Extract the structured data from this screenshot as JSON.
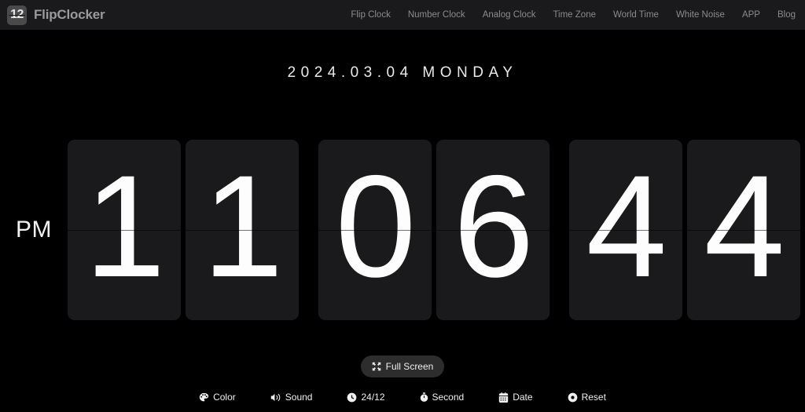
{
  "header": {
    "logo": {
      "icon": "flip-clock-logo-icon",
      "text": "12"
    },
    "brand": "FlipClocker",
    "nav": [
      {
        "label": "Flip Clock"
      },
      {
        "label": "Number Clock"
      },
      {
        "label": "Analog Clock"
      },
      {
        "label": "Time Zone"
      },
      {
        "label": "World Time"
      },
      {
        "label": "White Noise"
      },
      {
        "label": "APP"
      },
      {
        "label": "Blog"
      }
    ]
  },
  "main": {
    "date_line": "2024.03.04 MONDAY",
    "date": "2024.03.04",
    "weekday": "MONDAY",
    "meridiem": "PM",
    "time": {
      "hour": "11",
      "minute": "06",
      "second": "44",
      "digits": [
        "1",
        "1",
        "0",
        "6",
        "4",
        "4"
      ]
    },
    "fullscreen": {
      "label": "Full Screen",
      "icon": "expand-arrows-icon"
    }
  },
  "toolbar": [
    {
      "label": "Color",
      "icon": "palette-icon"
    },
    {
      "label": "Sound",
      "icon": "speaker-icon"
    },
    {
      "label": "24/12",
      "icon": "clock-icon"
    },
    {
      "label": "Second",
      "icon": "stopwatch-icon"
    },
    {
      "label": "Date",
      "icon": "calendar-icon"
    },
    {
      "label": "Reset",
      "icon": "reset-dot-icon"
    }
  ],
  "colors": {
    "background": "#000000",
    "header_bg": "#1a1a1d",
    "card_bg": "#1a1a1c",
    "digit": "#fdfdfd",
    "nav_text": "#8b8b8b",
    "brand_text": "#9a9a9a",
    "button_bg": "#2d2d2d"
  }
}
